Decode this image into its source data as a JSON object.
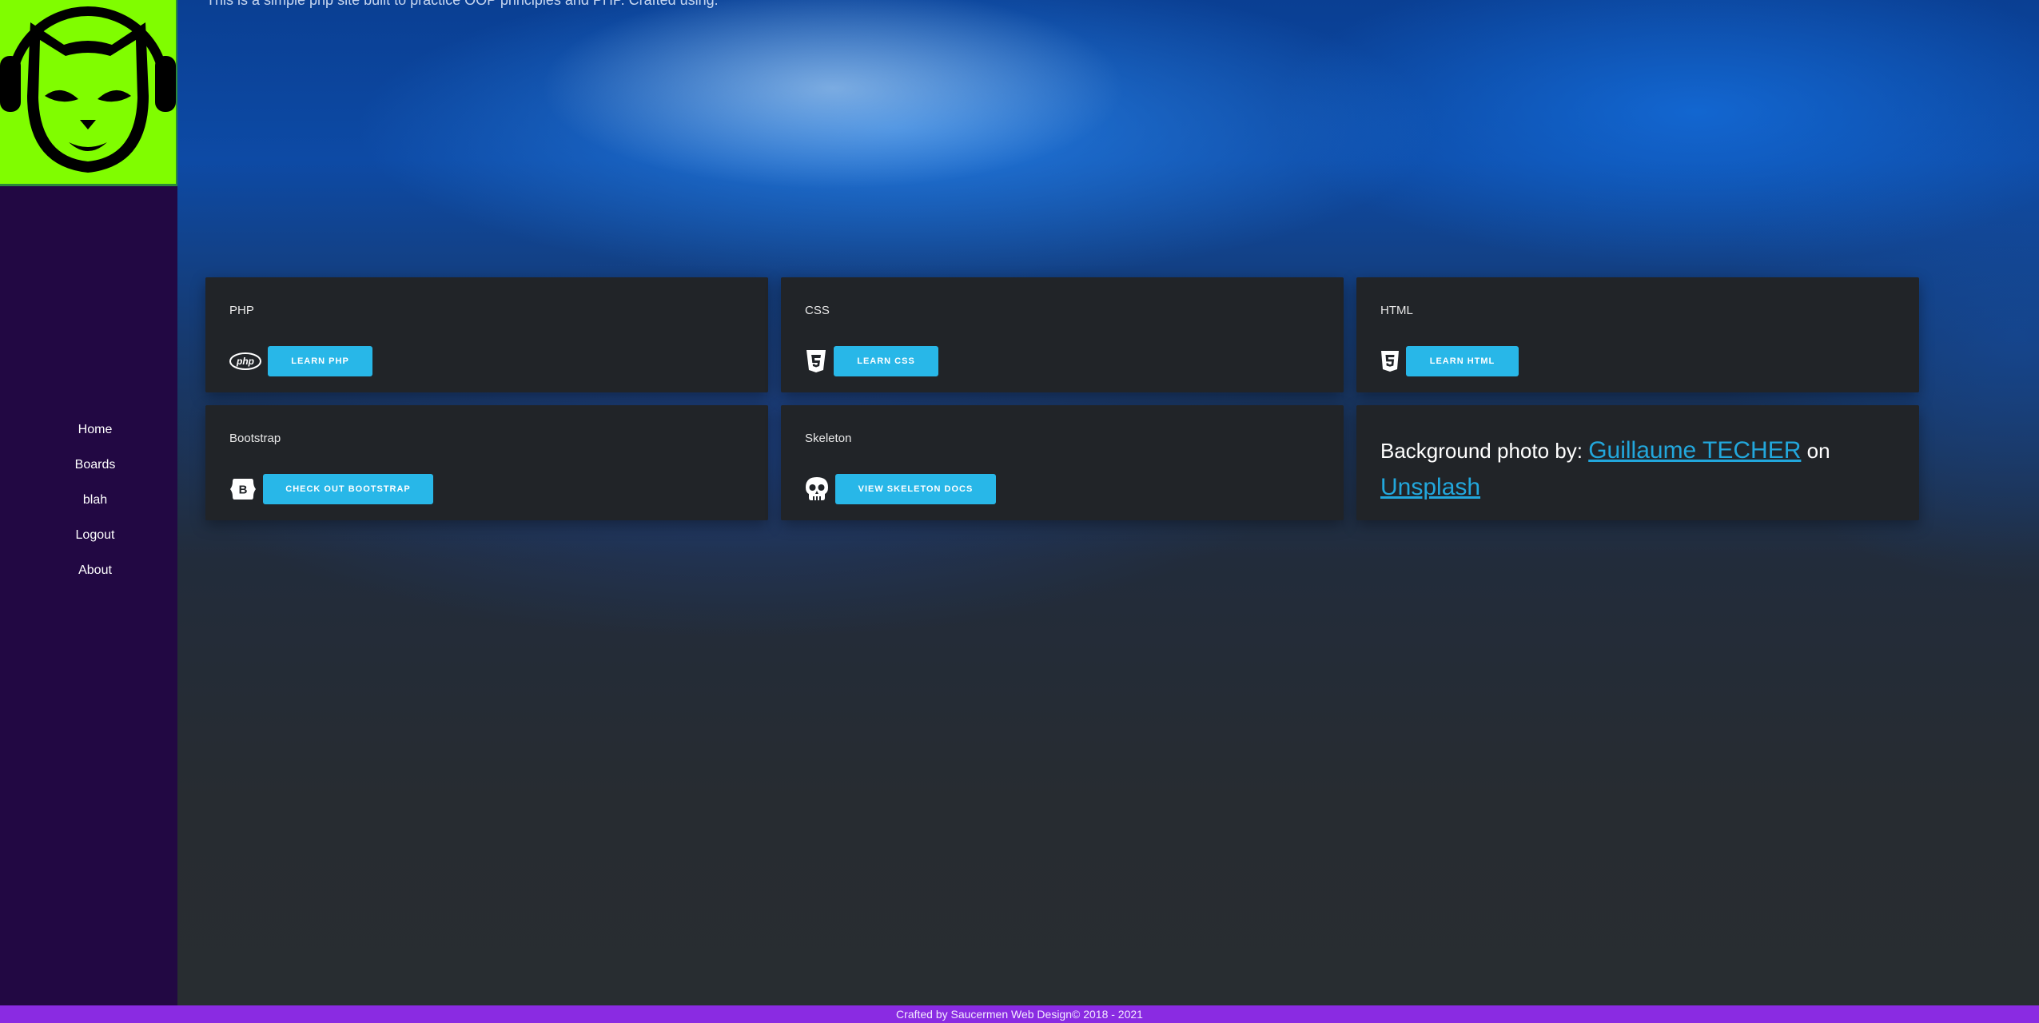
{
  "intro_text": "This is a simple php site built to practice OOP principles and PHP. Crafted using:",
  "logo": {
    "name": "napster-logo",
    "bg_color": "#80fd00"
  },
  "nav": {
    "items": [
      {
        "label": "Home"
      },
      {
        "label": "Boards"
      },
      {
        "label": "blah"
      },
      {
        "label": "Logout"
      },
      {
        "label": "About"
      }
    ]
  },
  "cards": {
    "php": {
      "title": "PHP",
      "icon": "php-icon",
      "button": "LEARN PHP"
    },
    "css": {
      "title": "CSS",
      "icon": "css3-icon",
      "button": "LEARN CSS"
    },
    "html": {
      "title": "HTML",
      "icon": "html5-icon",
      "button": "LEARN HTML"
    },
    "bootstrap": {
      "title": "Bootstrap",
      "icon": "bootstrap-icon",
      "button": "CHECK OUT BOOTSTRAP"
    },
    "skeleton": {
      "title": "Skeleton",
      "icon": "skull-icon",
      "button": "VIEW SKELETON DOCS"
    }
  },
  "credit": {
    "prefix": "Background photo by: ",
    "author": "Guillaume TECHER",
    "middle": " on",
    "site": "Unsplash"
  },
  "footer": {
    "text": "Crafted by Saucermen Web Design© 2018 - 2021"
  },
  "colors": {
    "sidebar": "#220843",
    "accent_button": "#28b7e8",
    "link": "#22a7dc",
    "card_bg": "#212428",
    "footer": "#8a2be2"
  }
}
